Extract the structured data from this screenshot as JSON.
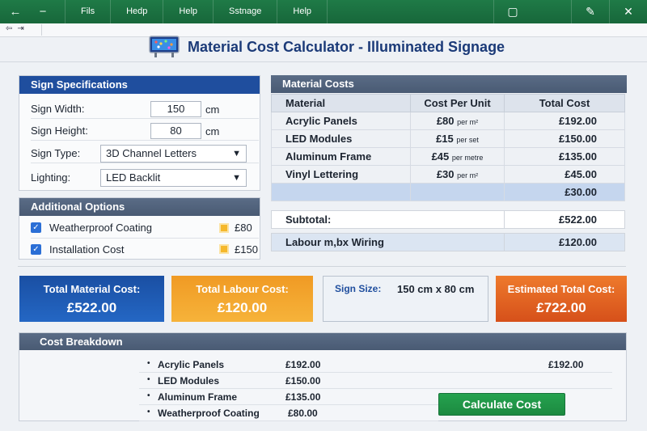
{
  "window": {
    "menus": [
      "Fils",
      "Hedp",
      "Help",
      "Sstnage",
      "Help"
    ],
    "controls": [
      "restore-icon",
      "edit-icon",
      "close-icon"
    ]
  },
  "app": {
    "title": "Material Cost Calculator - Illuminated Signage"
  },
  "sign_specs": {
    "heading": "Sign Specifications",
    "width": {
      "label": "Sign Width:",
      "value": "150",
      "unit": "cm"
    },
    "height": {
      "label": "Sign Height:",
      "value": "80",
      "unit": "cm"
    },
    "type": {
      "label": "Sign Type:",
      "value": "3D Channel Letters"
    },
    "lighting": {
      "label": "Lighting:",
      "value": "LED Backlit"
    }
  },
  "options": {
    "heading": "Additional Options",
    "items": [
      {
        "label": "Weatherproof Coating",
        "price": "£80"
      },
      {
        "label": "Installation Cost",
        "price": "£150"
      }
    ]
  },
  "material_costs": {
    "heading": "Material Costs",
    "columns": [
      "Material",
      "Cost Per Unit",
      "Total Cost"
    ],
    "rows": [
      {
        "material": "Acrylic Panels",
        "unit_cost": "£80",
        "per": "per m²",
        "total": "£192.00"
      },
      {
        "material": "LED Modules",
        "unit_cost": "£15",
        "per": "per set",
        "total": "£150.00"
      },
      {
        "material": "Aluminum Frame",
        "unit_cost": "£45",
        "per": "per metre",
        "total": "£135.00"
      },
      {
        "material": "Vinyl Lettering",
        "unit_cost": "£30",
        "per": "per m²",
        "total": "£45.00"
      }
    ],
    "highlight_total": "£30.00",
    "subtotal": {
      "label": "Subtotal:",
      "value": "£522.00"
    },
    "labour": {
      "label": "Labour m,bx Wiring",
      "value": "£120.00"
    }
  },
  "summary": {
    "material": {
      "label": "Total Material Cost:",
      "value": "£522.00"
    },
    "labour": {
      "label": "Total Labour Cost:",
      "value": "£120.00"
    },
    "size": {
      "label": "Sign Size:",
      "value": "150 cm x 80 cm"
    },
    "estimated": {
      "label": "Estimated Total Cost:",
      "value": "£722.00"
    }
  },
  "breakdown": {
    "heading": "Cost Breakdown",
    "items": [
      {
        "label": "Acrylic Panels",
        "value": "£192.00",
        "extra": "£192.00"
      },
      {
        "label": "LED Modules",
        "value": "£150.00"
      },
      {
        "label": "Aluminum Frame",
        "value": "£135.00"
      },
      {
        "label": "Weatherproof Coating",
        "value": "£80.00"
      }
    ],
    "button": "Calculate Cost"
  },
  "colors": {
    "titlebar": "#1f7a47",
    "header_blue": "#1f4e9e",
    "card_material": "#1f5fb8",
    "card_labour": "#f4a52a",
    "card_estimated": "#d9541b",
    "button_green": "#25a24f"
  }
}
